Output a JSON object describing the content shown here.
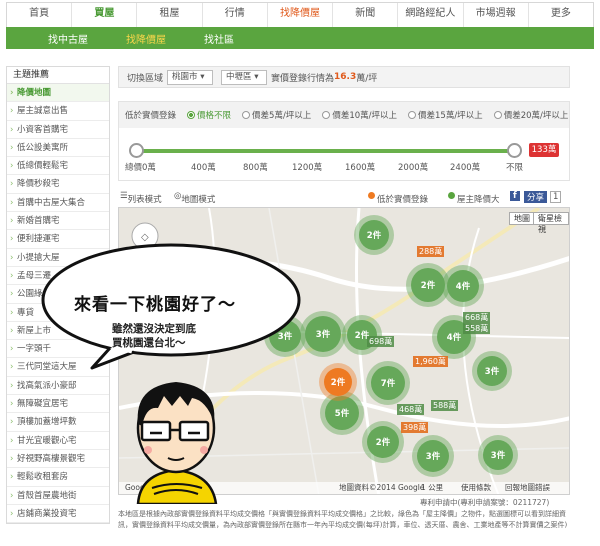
{
  "topnav": {
    "tabs": [
      {
        "label": "首頁",
        "state": "normal"
      },
      {
        "label": "買屋",
        "state": "active"
      },
      {
        "label": "租屋",
        "state": "normal"
      },
      {
        "label": "行情",
        "state": "normal"
      },
      {
        "label": "找降價屋",
        "state": "hot"
      },
      {
        "label": "新聞",
        "state": "normal"
      },
      {
        "label": "網路經紀人",
        "state": "normal"
      },
      {
        "label": "市場週報",
        "state": "normal"
      },
      {
        "label": "更多",
        "state": "normal"
      }
    ]
  },
  "subnav": {
    "items": [
      {
        "label": "找中古屋",
        "active": false
      },
      {
        "label": "找降價屋",
        "active": true
      },
      {
        "label": "找社區",
        "active": false
      }
    ]
  },
  "sidebar": {
    "title": "主題推薦",
    "items": [
      "降價地圖",
      "屋主誠意出售",
      "小資客首購宅",
      "低公設美寓所",
      "低總價輕鬆宅",
      "降價秒殺宅",
      "首購中古屋大集合",
      "新婚首購宅",
      "便利捷運宅",
      "小提搶大屋",
      "孟母三遷",
      "公園綠地宅",
      "專貸",
      "新屋上市",
      "一字頭千",
      "三代同堂這大屋",
      "找高氣派小豪邸",
      "無障礙宜居宅",
      "頂樓加蓋增坪數",
      "甘光宜暖觀心宅",
      "好視野高樓景觀宅",
      "輕鬆收租套房",
      "首殼首屋農地街",
      "店鋪商業投資宅"
    ]
  },
  "filter": {
    "label": "切換區域",
    "city": "桃園市",
    "district": "中壢區",
    "text_before": "實價登錄行情為",
    "price": "16.3",
    "unit": "萬/坪"
  },
  "range": {
    "label": "低於實價登錄",
    "options": [
      "價格不限",
      "價差5萬/坪以上",
      "價差10萬/坪以上",
      "價差15萬/坪以上",
      "價差20萬/坪以上"
    ],
    "ticks": [
      "總價0萬",
      "400萬",
      "800萬",
      "1200萬",
      "1600萬",
      "2000萬",
      "2400萬",
      "不限"
    ],
    "max_label": "133萬"
  },
  "viewbar": {
    "list_mode": "列表模式",
    "map_mode": "地圖模式",
    "below_label": "低於實價登錄",
    "owner_label": "屋主降價大",
    "fb": "f",
    "share": "分享",
    "plus": "1"
  },
  "map": {
    "btn_map": "地圖",
    "btn_sat": "衛星檢視",
    "clusters": [
      {
        "label": "2件",
        "kind": "g"
      },
      {
        "label": "2件",
        "kind": "g"
      },
      {
        "label": "4件",
        "kind": "g"
      },
      {
        "label": "3件",
        "kind": "g"
      },
      {
        "label": "3件",
        "kind": "g"
      },
      {
        "label": "2件",
        "kind": "g"
      },
      {
        "label": "4件",
        "kind": "g"
      },
      {
        "label": "7件",
        "kind": "g"
      },
      {
        "label": "5件",
        "kind": "g"
      },
      {
        "label": "2件",
        "kind": "g"
      },
      {
        "label": "3件",
        "kind": "g"
      },
      {
        "label": "3件",
        "kind": "g"
      },
      {
        "label": "2件",
        "kind": "o"
      },
      {
        "label": "3件",
        "kind": "g"
      }
    ],
    "price_labels": [
      "288萬",
      "698萬",
      "668萬",
      "558萬",
      "1,960萬",
      "468萬",
      "588萬",
      "398萬"
    ],
    "footer_left": "Google",
    "footer_mid": "地圖資料©2014 Google",
    "footer_scale": "1 公里",
    "footer_terms": "使用條款",
    "footer_report": "回報地圖錯誤"
  },
  "under_map": "專利申請中(專利申請案號：0211727)",
  "note": "本地區是根據內政部實價登錄資料平均成交價格「與實價登錄資料平均成交價格」之比較，綠色為「屋主降價」之物件，點選圖標可以看到詳細資訊，實價登錄資料平均成交價量，為內政部實價登錄所在縣市一年內平均成交價(每坪)計算，車位、透天厝、農舍、工業地產等不計算實價之案件)",
  "comic": {
    "line1": "來看一下桃園好了～",
    "line2": "雖然還沒決定到底",
    "line3": "買桃園還台北～"
  },
  "colors": {
    "green": "#5aa53f",
    "orange": "#ee7a22",
    "red": "#d33333"
  }
}
